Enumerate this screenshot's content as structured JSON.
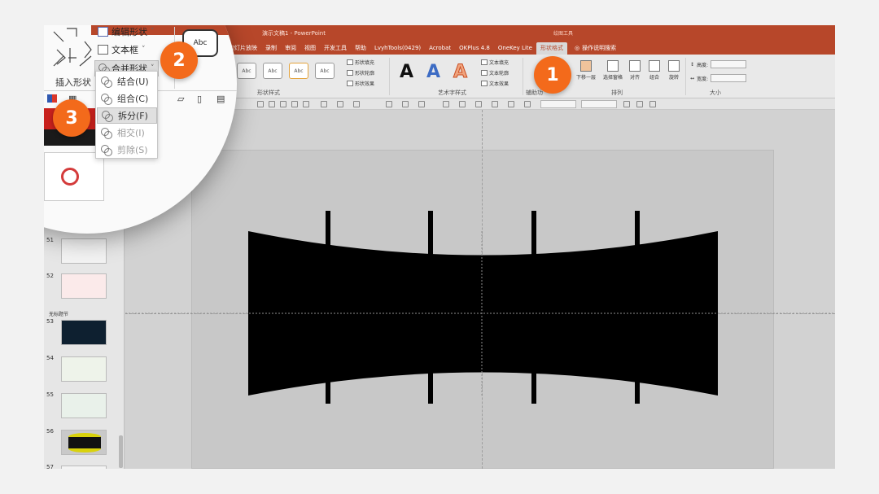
{
  "window": {
    "title": "演示文稿1 - PowerPoint",
    "context_group": "绘图工具"
  },
  "tabs": [
    {
      "label": "幻灯片放映"
    },
    {
      "label": "录制"
    },
    {
      "label": "审阅"
    },
    {
      "label": "视图"
    },
    {
      "label": "开发工具"
    },
    {
      "label": "帮助"
    },
    {
      "label": "LvyhTools(0429)"
    },
    {
      "label": "Acrobat"
    },
    {
      "label": "OKPlus 4.8"
    },
    {
      "label": "OneKey Lite"
    },
    {
      "label": "形状格式",
      "active": true
    }
  ],
  "tell_me": "操作说明搜索",
  "ribbon": {
    "shape_styles_label": "形状样式",
    "abc_label": "Abc",
    "shape_fill": "形状填充",
    "shape_outline": "形状轮廓",
    "shape_effect": "形状效果",
    "wordart_label": "艺术字样式",
    "wordart_glyph": "A",
    "text_fill": "文本填充",
    "text_outline": "文本轮廓",
    "text_effect": "文本效果",
    "accessibility_label": "辅助功",
    "arrange_label": "排列",
    "send_backward": "下移一层",
    "selection_pane": "选择窗格",
    "align": "对齐",
    "group": "组合",
    "rotate": "旋转",
    "size_label": "大小",
    "height_label": "高度:",
    "width_label": "宽度:"
  },
  "magnifier": {
    "edit_shape": "编辑形状",
    "text_box": "文本框",
    "merge_shapes": "合并形状",
    "insert_shapes_label": "插入形状",
    "abc_preview": "Abc",
    "merge_menu": [
      {
        "label": "结合(U)",
        "enabled": true
      },
      {
        "label": "组合(C)",
        "enabled": true
      },
      {
        "label": "拆分(F)",
        "enabled": true,
        "hover": true
      },
      {
        "label": "相交(I)",
        "enabled": false
      },
      {
        "label": "剪除(S)",
        "enabled": false
      }
    ]
  },
  "thumbnails": {
    "section_name": "无标题节",
    "slides": [
      {
        "num": "51"
      },
      {
        "num": "52"
      },
      {
        "num": "53"
      },
      {
        "num": "54"
      },
      {
        "num": "55"
      },
      {
        "num": "56"
      },
      {
        "num": "57"
      }
    ]
  },
  "steps": [
    {
      "label": "1"
    },
    {
      "label": "2"
    },
    {
      "label": "3"
    }
  ],
  "colors": {
    "ribbon_red": "#b7472a",
    "badge_orange": "#f36a1b",
    "shape_fill": "#000000"
  }
}
